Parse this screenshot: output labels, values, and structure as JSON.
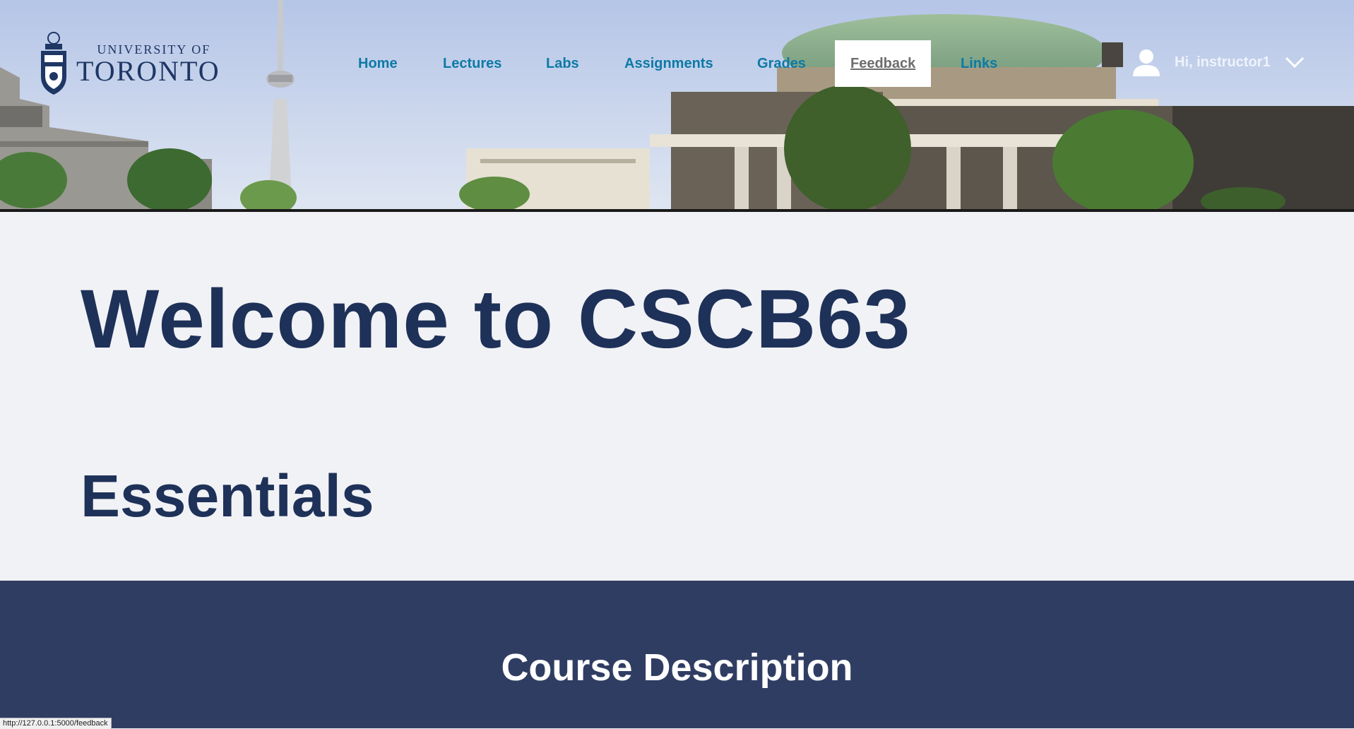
{
  "header": {
    "logo": {
      "line1": "UNIVERSITY OF",
      "line2": "TORONTO"
    },
    "nav": [
      {
        "label": "Home"
      },
      {
        "label": "Lectures"
      },
      {
        "label": "Labs"
      },
      {
        "label": "Assignments"
      },
      {
        "label": "Grades"
      },
      {
        "label": "Feedback",
        "active": true
      },
      {
        "label": "Links"
      }
    ],
    "user": {
      "greeting": "Hi, instructor1",
      "avatar_icon": "user-icon",
      "menu_icon": "chevron-down-icon"
    }
  },
  "main": {
    "welcome_title": "Welcome to CSCB63",
    "section_title": "Essentials"
  },
  "description": {
    "title": "Course Description"
  },
  "status_bar": {
    "url": "http://127.0.0.1:5000/feedback"
  },
  "colors": {
    "nav_link": "#0d7aa6",
    "heading": "#1e3158",
    "band": "#303d63",
    "page_bg": "#f1f2f6"
  }
}
